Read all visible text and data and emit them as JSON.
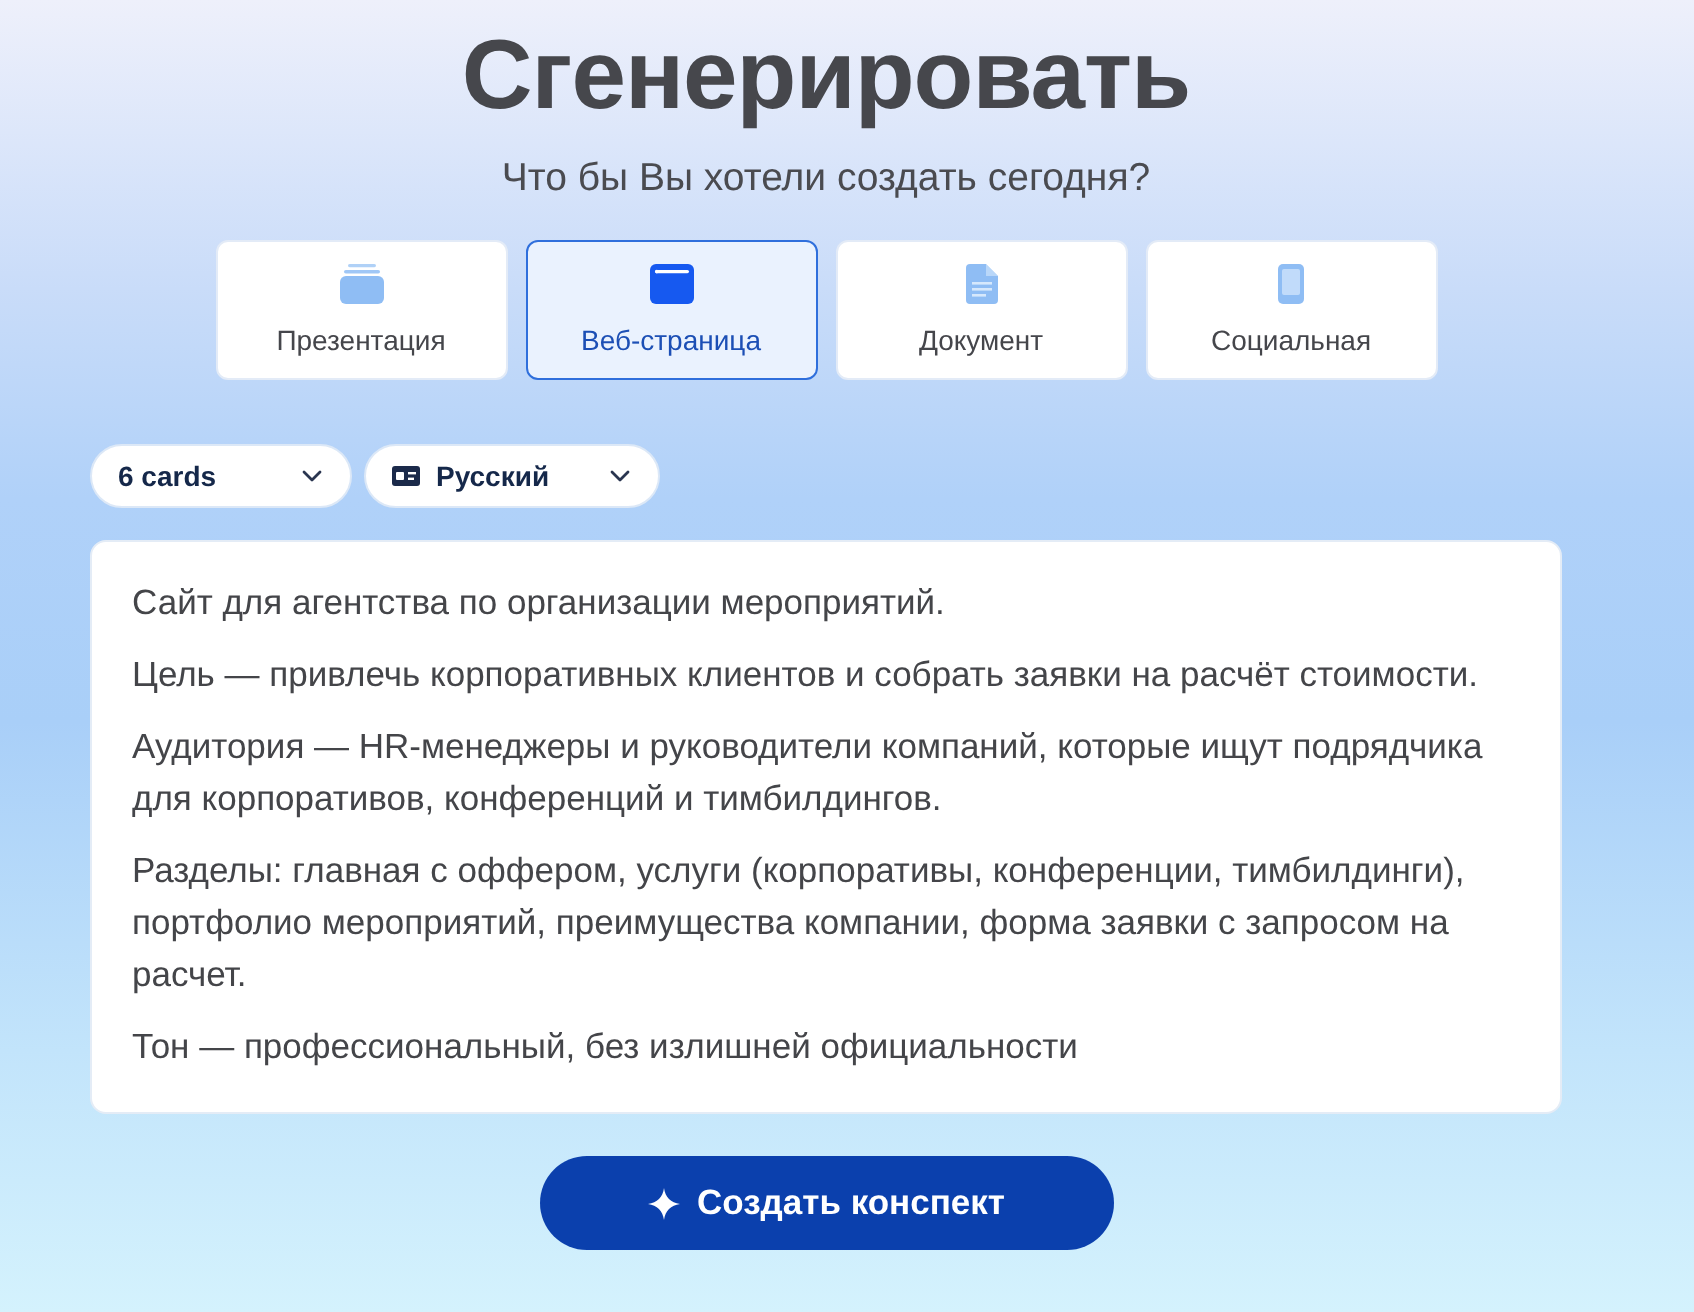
{
  "header": {
    "title": "Сгенерировать",
    "subtitle": "Что бы Вы хотели создать сегодня?"
  },
  "formats": [
    {
      "kind": "presentation",
      "label": "Презентация",
      "selected": false
    },
    {
      "kind": "webpage",
      "label": "Веб-страница",
      "selected": true
    },
    {
      "kind": "document",
      "label": "Документ",
      "selected": false
    },
    {
      "kind": "social",
      "label": "Социальная",
      "selected": false
    }
  ],
  "options": [
    {
      "kind": "count",
      "value": "6 cards"
    },
    {
      "kind": "language",
      "value": "Русский"
    }
  ],
  "prompt": {
    "paragraphs": [
      "Сайт для агентства по организации мероприятий.",
      "Цель — привлечь корпоративных клиентов и собрать заявки на расчёт стоимости.",
      "Аудитория — HR-менеджеры и руководители компаний, которые ищут подрядчика для корпоративов, конференций и тимбилдингов.",
      "Разделы: главная с оффером, услуги (корпоративы, конференции, тимбилдинги), портфолио мероприятий, преимущества компании, форма заявки с запросом на расчет.",
      "Тон — профессиональный, без излишней официальности"
    ]
  },
  "submit": {
    "label": "Создать конспект"
  }
}
